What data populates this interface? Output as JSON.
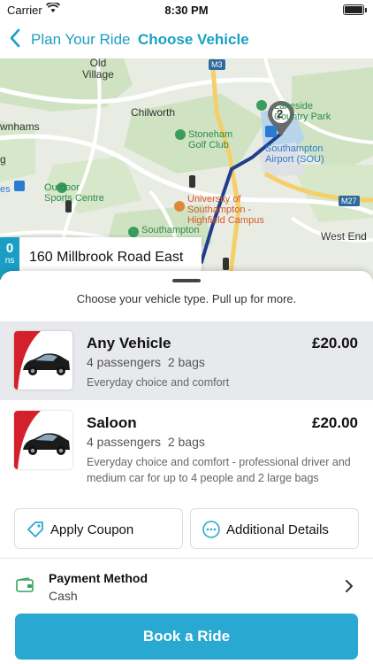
{
  "status": {
    "carrier": "Carrier",
    "time": "8:30 PM"
  },
  "nav": {
    "back_label": "Plan Your Ride",
    "title": "Choose Vehicle"
  },
  "map": {
    "labels": {
      "old_village": "Old\nVillage",
      "m3": "M3",
      "chilworth": "Chilworth",
      "wnhams": "wnhams",
      "stoneham": "Stoneham\nGolf Club",
      "lakeside": "Lakeside\nCountry Park",
      "airport": "Southampton\nAirport (SOU)",
      "outdoor": "Outdoor\nSports Centre",
      "uni": "University of\nSouthampton -\nHighfield Campus",
      "m27": "M27",
      "west_end": "West End",
      "southampton_common": "Southampton",
      "es": "es",
      "g": "g",
      "pin_count": "2"
    }
  },
  "pickup": {
    "eta_value": "0",
    "eta_unit": "ns",
    "address": "160 Millbrook Road East"
  },
  "sheet": {
    "hint": "Choose your vehicle type. Pull up for more."
  },
  "vehicles": [
    {
      "name": "Any Vehicle",
      "price": "£20.00",
      "passengers": "4 passengers",
      "bags": "2 bags",
      "description": "Everyday choice and comfort"
    },
    {
      "name": "Saloon",
      "price": "£20.00",
      "passengers": "4 passengers",
      "bags": "2 bags",
      "description": "Everyday choice and comfort - professional driver and medium car for up to 4 people and 2 large bags"
    }
  ],
  "actions": {
    "coupon": "Apply Coupon",
    "details": "Additional Details"
  },
  "payment": {
    "title": "Payment Method",
    "value": "Cash"
  },
  "book": {
    "label": "Book a Ride"
  },
  "colors": {
    "accent": "#29a9d2",
    "nav_text": "#1a9fc4",
    "selected_row": "#e8e9ec"
  },
  "icons": {
    "back": "chevron-left-icon",
    "coupon": "tag-icon",
    "details": "more-dots-icon",
    "payment": "wallet-icon",
    "chevron": "chevron-right-icon"
  }
}
